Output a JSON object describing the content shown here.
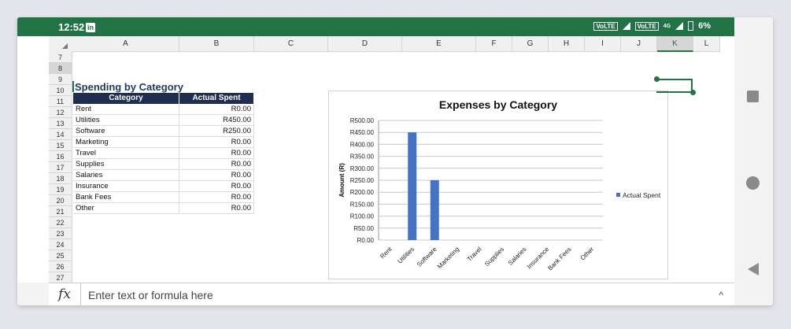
{
  "status_bar": {
    "time": "12:52",
    "linkedin_badge": "in",
    "volte1": "VoLTE",
    "volte2": "VoLTE",
    "net": "4G",
    "battery": "6%"
  },
  "columns": [
    "A",
    "B",
    "C",
    "D",
    "E",
    "F",
    "G",
    "H",
    "I",
    "J",
    "K",
    "L"
  ],
  "selected_column": "K",
  "rows": [
    "7",
    "8",
    "9",
    "10",
    "11",
    "12",
    "13",
    "14",
    "15",
    "16",
    "17",
    "18",
    "19",
    "20",
    "21",
    "22",
    "23",
    "24",
    "25",
    "26",
    "27"
  ],
  "sheet": {
    "title": "Spending by Category",
    "headers": {
      "category": "Category",
      "actual": "Actual Spent"
    },
    "items": [
      {
        "category": "Rent",
        "value": "R0.00"
      },
      {
        "category": "Utilities",
        "value": "R450.00"
      },
      {
        "category": "Software",
        "value": "R250.00"
      },
      {
        "category": "Marketing",
        "value": "R0.00"
      },
      {
        "category": "Travel",
        "value": "R0.00"
      },
      {
        "category": "Supplies",
        "value": "R0.00"
      },
      {
        "category": "Salaries",
        "value": "R0.00"
      },
      {
        "category": "Insurance",
        "value": "R0.00"
      },
      {
        "category": "Bank Fees",
        "value": "R0.00"
      },
      {
        "category": "Other",
        "value": "R0.00"
      }
    ]
  },
  "chart_data": {
    "type": "bar",
    "title": "Expenses by Category",
    "ylabel": "Amount (R)",
    "xlabel": "",
    "categories": [
      "Rent",
      "Utilities",
      "Software",
      "Marketing",
      "Travel",
      "Supplies",
      "Salaries",
      "Insurance",
      "Bank Fees",
      "Other"
    ],
    "series": [
      {
        "name": "Actual Spent",
        "values": [
          0,
          450,
          250,
          0,
          0,
          0,
          0,
          0,
          0,
          0
        ],
        "color": "#4472c4"
      }
    ],
    "ylim": [
      0,
      500
    ],
    "yticks": [
      "R0.00",
      "R50.00",
      "R100.00",
      "R150.00",
      "R200.00",
      "R250.00",
      "R300.00",
      "R350.00",
      "R400.00",
      "R450.00",
      "R500.00"
    ],
    "grid": true,
    "legend": "right"
  },
  "formula_bar": {
    "fx": "fx",
    "placeholder": "Enter text or formula here",
    "expand": "^"
  },
  "colors": {
    "excel_green": "#217346",
    "header_navy": "#1f2d4e",
    "bar_blue": "#4472c4"
  }
}
